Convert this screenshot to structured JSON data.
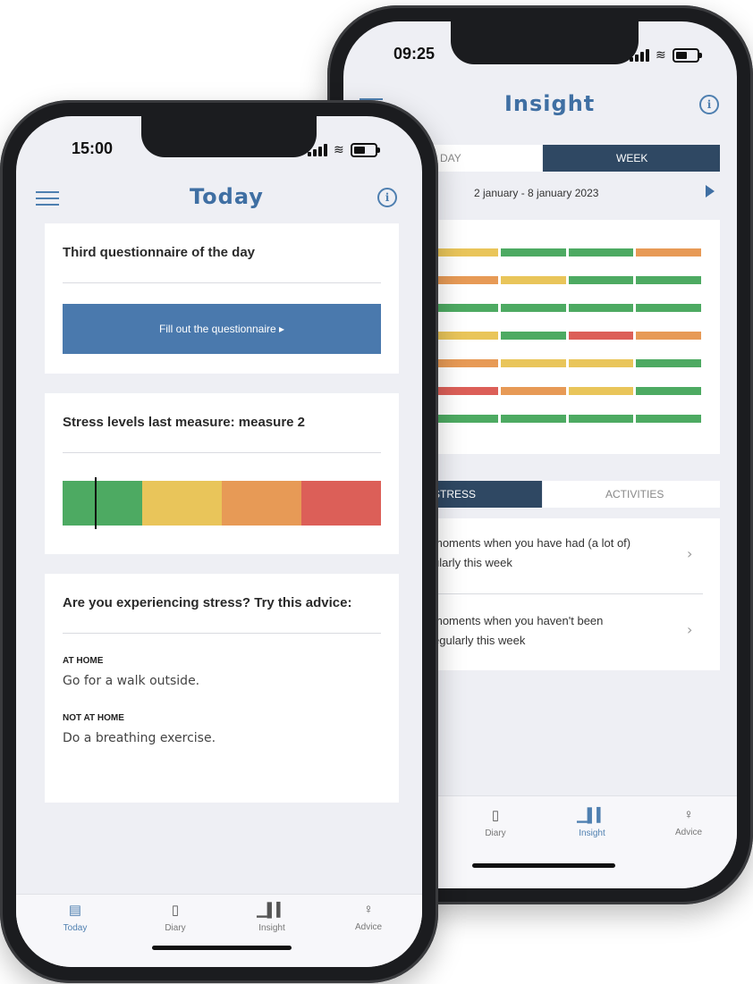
{
  "colors": {
    "accent": "#4a79ad",
    "navy": "#2f4863",
    "green": "#4daa62",
    "yellow": "#e9c55a",
    "orange": "#e79a56",
    "red": "#dc5f58"
  },
  "back_phone": {
    "status_time": "09:25",
    "header": {
      "title": "Insight"
    },
    "tabs": {
      "day": "DAY",
      "week": "WEEK"
    },
    "date_range": "2 january - 8 january 2023",
    "rows": [
      [
        "yellow",
        "green",
        "green",
        "orange"
      ],
      [
        "orange",
        "yellow",
        "green",
        "green"
      ],
      [
        "green",
        "green",
        "green",
        "green"
      ],
      [
        "yellow",
        "green",
        "red",
        "orange"
      ],
      [
        "orange",
        "yellow",
        "yellow",
        "green"
      ],
      [
        "red",
        "orange",
        "yellow",
        "green"
      ],
      [
        "green",
        "green",
        "green",
        "green"
      ]
    ],
    "sub_tabs": {
      "stress": "STRESS",
      "activities": "ACTIVITIES"
    },
    "list": [
      {
        "line1": "moments when you have had (a lot of)",
        "line2": "ularly this week"
      },
      {
        "line1": "moments when you haven't been",
        "line2": "egularly this week"
      }
    ],
    "tabbar": [
      {
        "label": "Diary",
        "icon": "diary-icon"
      },
      {
        "label": "Insight",
        "icon": "insight-icon"
      },
      {
        "label": "Advice",
        "icon": "advice-icon"
      }
    ]
  },
  "front_phone": {
    "status_time": "15:00",
    "header": {
      "title": "Today"
    },
    "questionnaire": {
      "title": "Third questionnaire of the day",
      "button": "Fill out the questionnaire ▸"
    },
    "stress": {
      "title": "Stress levels last measure: measure 2",
      "marker_level": 0.1
    },
    "advice": {
      "title": "Are you experiencing stress? Try this advice:",
      "home_label": "AT HOME",
      "home_text": "Go for a walk outside.",
      "away_label": "NOT AT HOME",
      "away_text": "Do a breathing exercise."
    },
    "tabbar": [
      {
        "label": "Today",
        "icon": "today-icon"
      },
      {
        "label": "Diary",
        "icon": "diary-icon"
      },
      {
        "label": "Insight",
        "icon": "insight-icon"
      },
      {
        "label": "Advice",
        "icon": "advice-icon"
      }
    ]
  }
}
